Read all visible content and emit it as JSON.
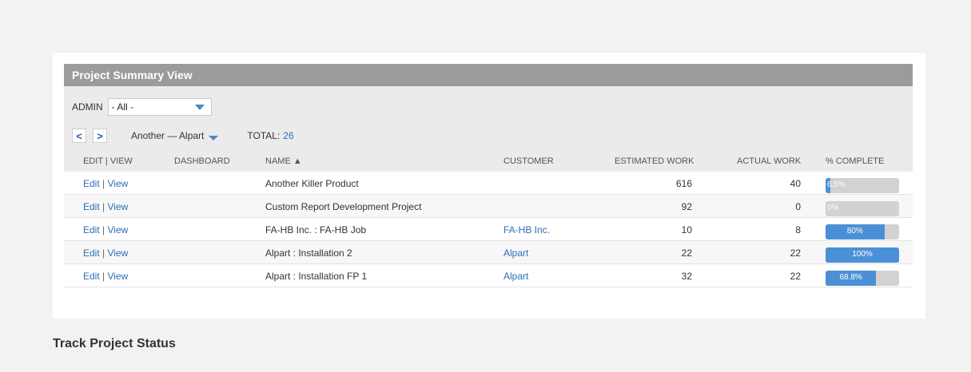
{
  "panel": {
    "title": "Project Summary View"
  },
  "filter": {
    "label": "ADMIN",
    "value": "- All -"
  },
  "nav": {
    "prev": "<",
    "next": ">",
    "project": "Another — Alpart",
    "total_label": "TOTAL:",
    "total_value": "26"
  },
  "columns": {
    "edit_view": "EDIT | VIEW",
    "dashboard": "DASHBOARD",
    "name": "NAME ▲",
    "customer": "CUSTOMER",
    "estimated": "ESTIMATED WORK",
    "actual": "ACTUAL WORK",
    "complete": "% COMPLETE"
  },
  "rows": [
    {
      "edit": "Edit",
      "view": "View",
      "name": "Another Killer Product",
      "customer": "",
      "estimated": "616",
      "actual": "40",
      "complete_label": "6.5%",
      "complete": 6.5
    },
    {
      "edit": "Edit",
      "view": "View",
      "name": "Custom Report Development Project",
      "customer": "",
      "estimated": "92",
      "actual": "0",
      "complete_label": "0%",
      "complete": 0
    },
    {
      "edit": "Edit",
      "view": "View",
      "name": "FA-HB Inc. : FA-HB Job",
      "customer": "FA-HB Inc.",
      "estimated": "10",
      "actual": "8",
      "complete_label": "80%",
      "complete": 80
    },
    {
      "edit": "Edit",
      "view": "View",
      "name": "Alpart : Installation 2",
      "customer": "Alpart",
      "estimated": "22",
      "actual": "22",
      "complete_label": "100%",
      "complete": 100
    },
    {
      "edit": "Edit",
      "view": "View",
      "name": "Alpart : Installation FP 1",
      "customer": "Alpart",
      "estimated": "32",
      "actual": "22",
      "complete_label": "68.8%",
      "complete": 68.8
    }
  ],
  "caption": "Track Project Status",
  "colors": {
    "accent": "#2b6fb4",
    "bar_fill": "#4b90d6",
    "header_bg": "#9b9b9b"
  }
}
